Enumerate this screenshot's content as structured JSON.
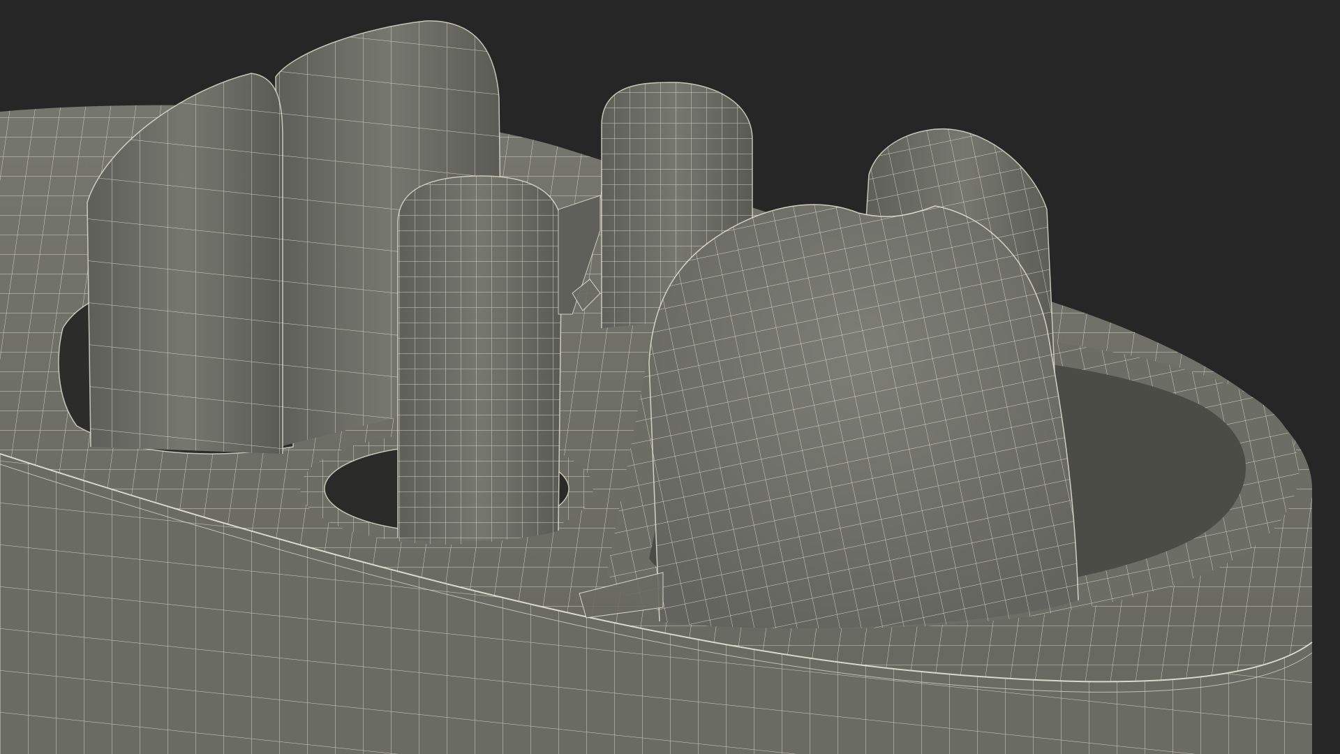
{
  "scene": {
    "subject": "wireframe-3d-render",
    "colors": {
      "background": "#262626",
      "surface": "#6f7068",
      "surface_light": "#7a7b73",
      "surface_dark": "#55564f",
      "cavity": "#2c2d2a",
      "wire": "#e6e4d6"
    }
  }
}
